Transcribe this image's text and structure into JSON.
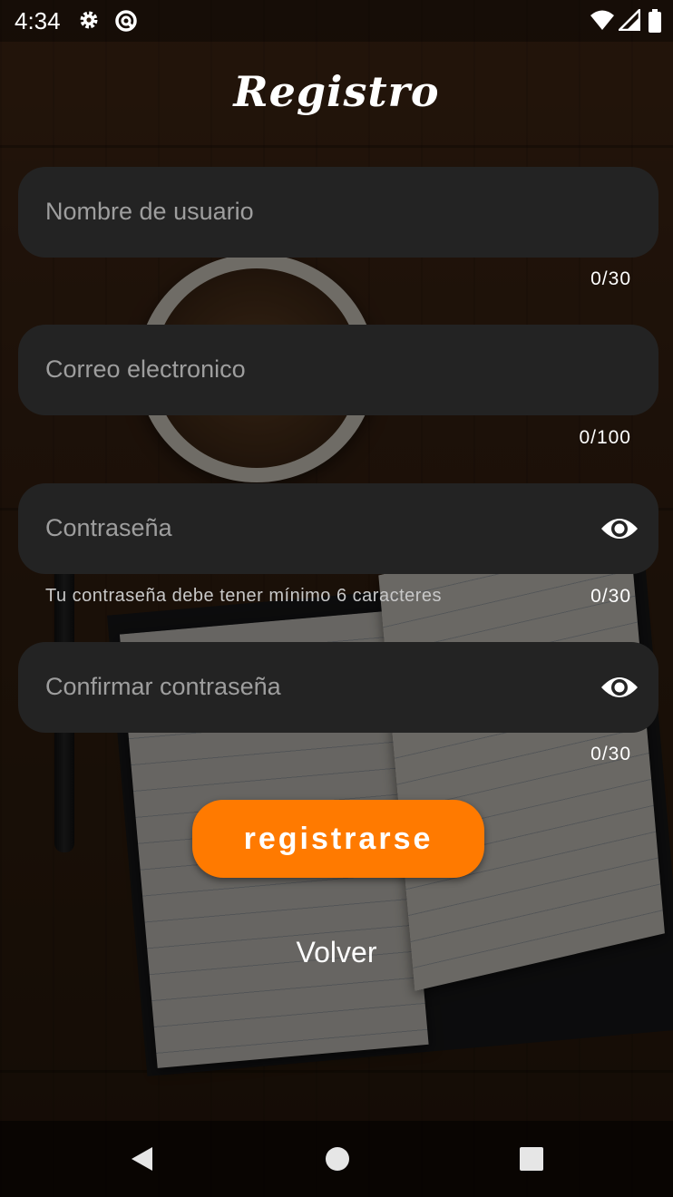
{
  "status_bar": {
    "time": "4:34",
    "icons": [
      "settings-icon",
      "sync-icon",
      "wifi-icon",
      "signal-icon",
      "battery-icon"
    ]
  },
  "screen": {
    "title": "Registro"
  },
  "form": {
    "username": {
      "placeholder": "Nombre de usuario",
      "counter": "0/30"
    },
    "email": {
      "placeholder": "Correo electronico",
      "counter": "0/100"
    },
    "password": {
      "placeholder": "Contraseña",
      "helper": "Tu contraseña debe tener mínimo 6 caracteres",
      "counter": "0/30",
      "toggle_icon": "eye-icon"
    },
    "confirm_password": {
      "placeholder": "Confirmar contraseña",
      "counter": "0/30",
      "toggle_icon": "eye-icon"
    }
  },
  "actions": {
    "register_label": "registrarse",
    "back_label": "Volver"
  },
  "nav_bar": {
    "buttons": [
      "back-icon",
      "home-icon",
      "recents-icon"
    ]
  },
  "colors": {
    "accent": "#ff7a00",
    "field_background": "#232323",
    "placeholder": "#9e9e9e"
  }
}
